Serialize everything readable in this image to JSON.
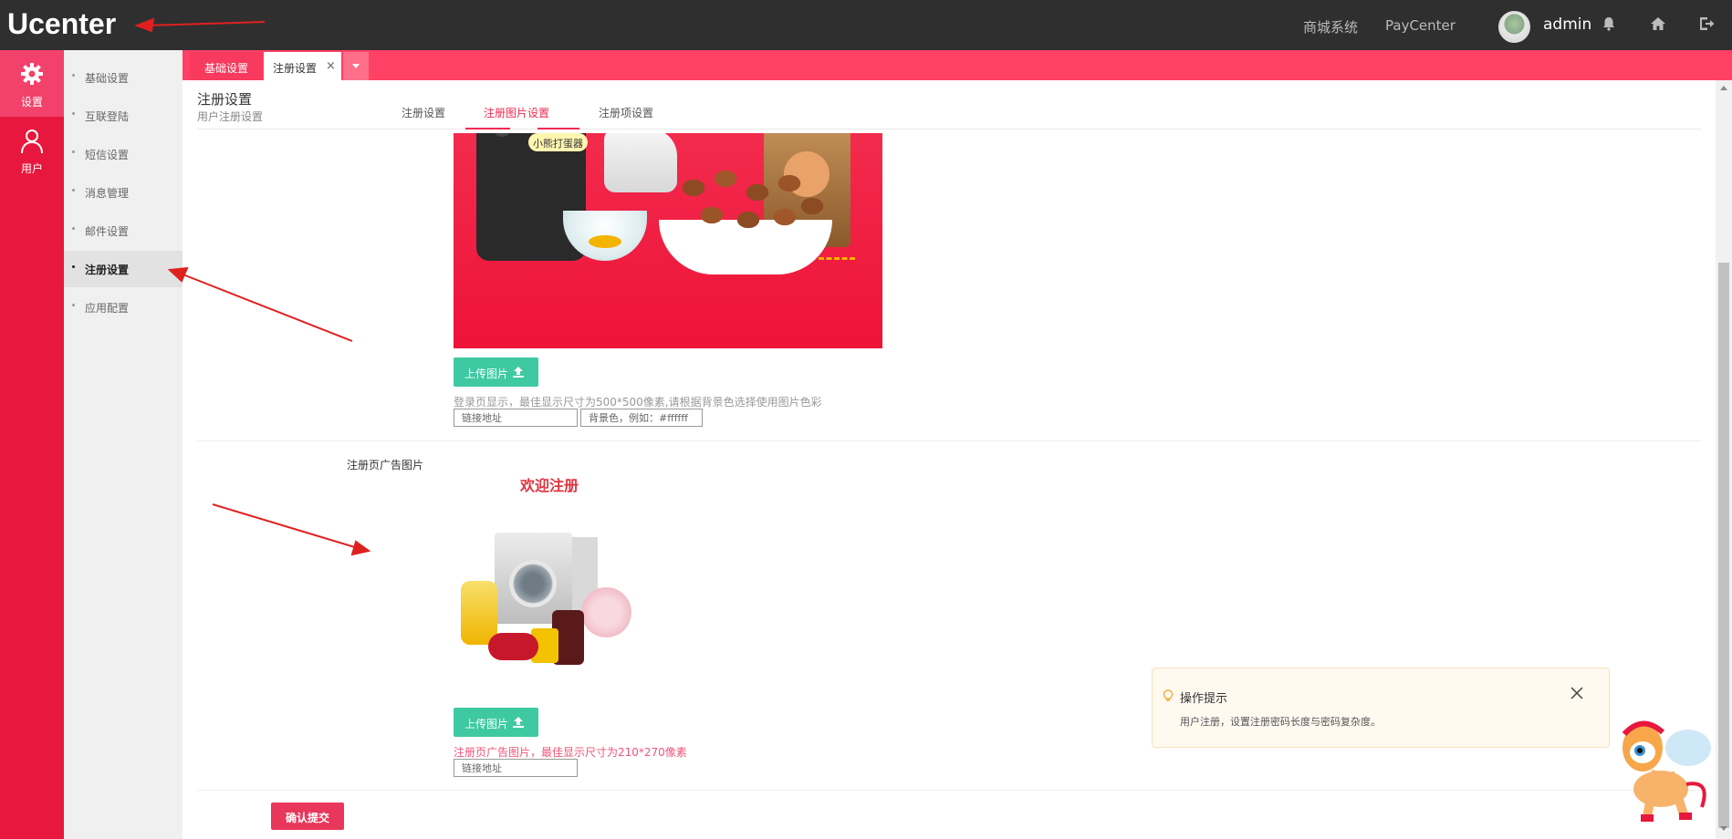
{
  "app": {
    "logo": "Ucenter"
  },
  "topbar": {
    "links": [
      "商城系统",
      "PayCenter"
    ],
    "username": "admin"
  },
  "rail": [
    {
      "label": "设置",
      "icon": "gear-icon",
      "active": true
    },
    {
      "label": "用户",
      "icon": "user-icon",
      "active": false
    }
  ],
  "sidebar": {
    "items": [
      {
        "label": "基础设置"
      },
      {
        "label": "互联登陆"
      },
      {
        "label": "短信设置"
      },
      {
        "label": "消息管理"
      },
      {
        "label": "邮件设置"
      },
      {
        "label": "注册设置",
        "active": true
      },
      {
        "label": "应用配置"
      }
    ]
  },
  "tabs": {
    "items": [
      {
        "label": "基础设置"
      },
      {
        "label": "注册设置",
        "active": true
      }
    ],
    "close_symbol": "×"
  },
  "page": {
    "title": "注册设置",
    "subtitle": "用户注册设置",
    "subtabs": [
      {
        "label": "注册设置"
      },
      {
        "label": "注册图片设置",
        "active": true
      },
      {
        "label": "注册项设置"
      }
    ]
  },
  "login_image": {
    "tag_text": "小熊打蛋器",
    "upload_label": "上传图片",
    "hint": "登录页显示，最佳显示尺寸为500*500像素,请根据背景色选择使用图片色彩",
    "link_placeholder": "链接地址",
    "bgcolor_placeholder": "背景色，例如：#ffffff"
  },
  "ad_image": {
    "row_label": "注册页广告图片",
    "title": "欢迎注册",
    "upload_label": "上传图片",
    "hint": "注册页广告图片，最佳显示尺寸为210*270像素",
    "link_placeholder": "链接地址"
  },
  "submit_label": "确认提交",
  "tip": {
    "title": "操作提示",
    "body": "用户注册，设置注册密码长度与密码复杂度。"
  },
  "colors": {
    "topbar": "#2f2f2f",
    "rail": "#e8173d",
    "tabstrip": "#ff4165",
    "accent": "#f02a52",
    "upload_button": "#3fc9a2",
    "submit_button": "#e8375a"
  }
}
